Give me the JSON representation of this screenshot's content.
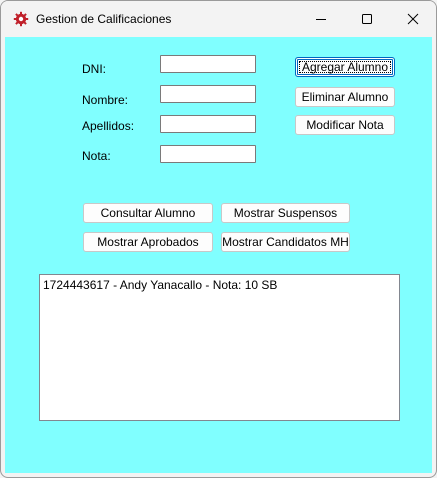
{
  "window": {
    "title": "Gestion de Calificaciones",
    "app_icon": "red-gear-icon",
    "controls": [
      "minimize-icon",
      "maximize-icon",
      "close-icon"
    ]
  },
  "form": {
    "dni_label": "DNI:",
    "nombre_label": "Nombre:",
    "apellidos_label": "Apellidos:",
    "nota_label": "Nota:",
    "dni_value": "",
    "nombre_value": "",
    "apellidos_value": "",
    "nota_value": ""
  },
  "buttons": {
    "agregar": "Agregar Alumno",
    "eliminar": "Eliminar Alumno",
    "modificar": "Modificar Nota",
    "consultar": "Consultar Alumno",
    "suspensos": "Mostrar Suspensos",
    "aprobados": "Mostrar Aprobados",
    "candidatos": "Mostrar Candidatos MH"
  },
  "results": {
    "items": [
      "1724443617 - Andy Yanacallo - Nota: 10 SB"
    ]
  },
  "colors": {
    "client_background": "#80ffff",
    "titlebar_background": "#f3f3f3"
  }
}
